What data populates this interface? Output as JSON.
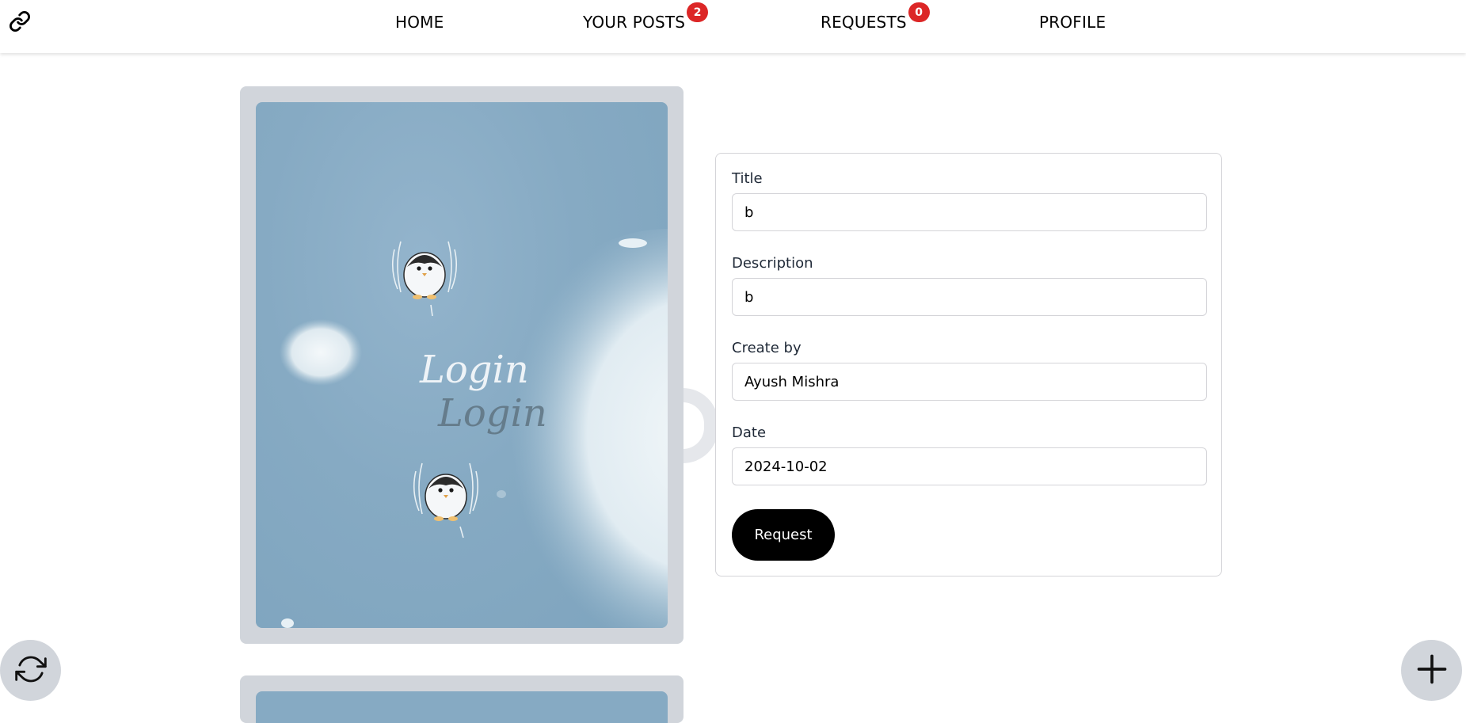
{
  "nav": {
    "items": [
      {
        "label": "HOME"
      },
      {
        "label": "YOUR POSTS",
        "badge": "2"
      },
      {
        "label": "REQUESTS",
        "badge": "0"
      },
      {
        "label": "PROFILE"
      }
    ],
    "badge_color": "#dc2626"
  },
  "post": {
    "image_text_primary": "Login",
    "image_text_secondary": "Login"
  },
  "form": {
    "fields": [
      {
        "label": "Title",
        "value": "b"
      },
      {
        "label": "Description",
        "value": "b"
      },
      {
        "label": "Create by",
        "value": "Ayush Mishra"
      },
      {
        "label": "Date",
        "value": "2024-10-02"
      }
    ],
    "submit_label": "Request"
  },
  "icons": {
    "logo": "link-icon",
    "refresh": "refresh-icon",
    "add": "plus-icon"
  }
}
